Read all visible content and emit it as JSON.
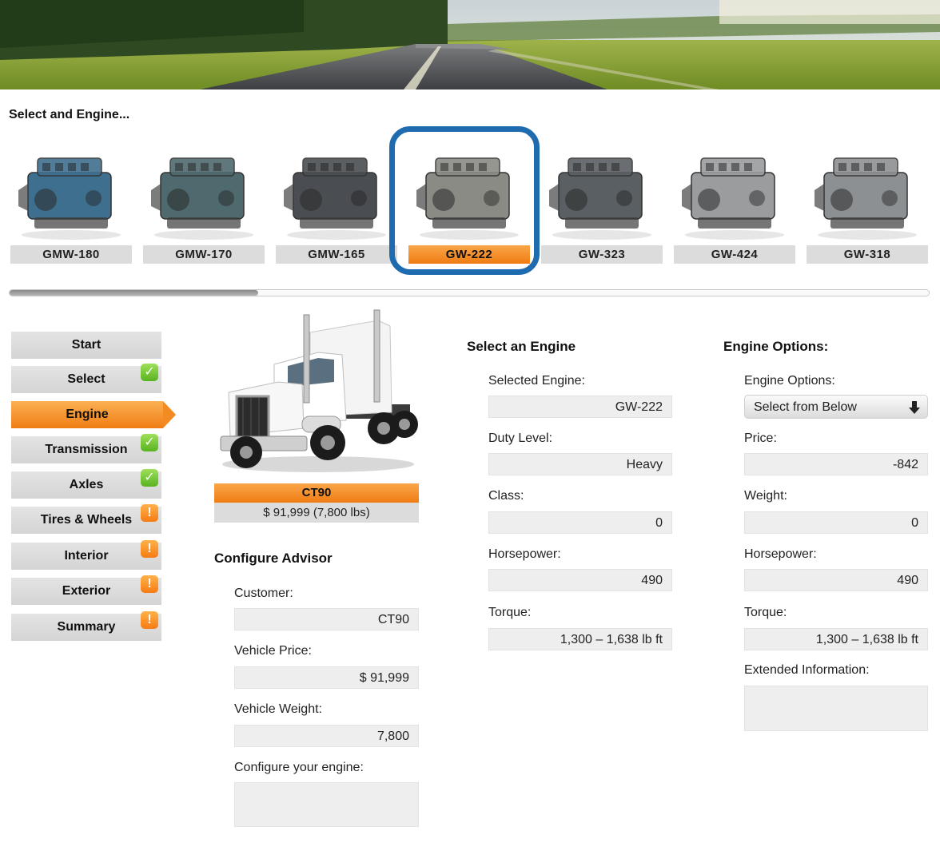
{
  "engine_selector": {
    "title": "Select and Engine...",
    "engines": [
      {
        "label": "GMW-180",
        "selected": false,
        "color": "#3f6f8e"
      },
      {
        "label": "GMW-170",
        "selected": false,
        "color": "#4f6a6e"
      },
      {
        "label": "GMW-165",
        "selected": false,
        "color": "#4a4e52"
      },
      {
        "label": "GW-222",
        "selected": true,
        "color": "#8b8b85"
      },
      {
        "label": "GW-323",
        "selected": false,
        "color": "#5a5f63"
      },
      {
        "label": "GW-424",
        "selected": false,
        "color": "#9a9c9e"
      },
      {
        "label": "GW-318",
        "selected": false,
        "color": "#8d9092"
      }
    ],
    "scroll_fraction": 0.27
  },
  "nav": {
    "items": [
      {
        "label": "Start",
        "status": "none"
      },
      {
        "label": "Select",
        "status": "complete"
      },
      {
        "label": "Engine",
        "status": "active"
      },
      {
        "label": "Transmission",
        "status": "complete"
      },
      {
        "label": "Axles",
        "status": "complete"
      },
      {
        "label": "Tires & Wheels",
        "status": "warning"
      },
      {
        "label": "Interior",
        "status": "warning"
      },
      {
        "label": "Exterior",
        "status": "warning"
      },
      {
        "label": "Summary",
        "status": "warning"
      }
    ]
  },
  "truck": {
    "name": "CT90",
    "price_weight": "$ 91,999 (7,800 lbs)"
  },
  "configure_advisor": {
    "title": "Configure Advisor",
    "customer_label": "Customer:",
    "customer_value": "CT90",
    "vehicle_price_label": "Vehicle Price:",
    "vehicle_price_value": "$ 91,999",
    "vehicle_weight_label": "Vehicle Weight:",
    "vehicle_weight_value": "7,800",
    "configure_label": "Configure your engine:",
    "configure_value": ""
  },
  "select_engine": {
    "title": "Select an Engine",
    "selected_engine_label": "Selected Engine:",
    "selected_engine_value": "GW-222",
    "duty_level_label": "Duty Level:",
    "duty_level_value": "Heavy",
    "class_label": "Class:",
    "class_value": "0",
    "horsepower_label": "Horsepower:",
    "horsepower_value": "490",
    "torque_label": "Torque:",
    "torque_value": "1,300 – 1,638 lb ft"
  },
  "engine_options": {
    "title": "Engine Options:",
    "options_label": "Engine Options:",
    "options_value": "Select from Below",
    "price_label": "Price:",
    "price_value": "-842",
    "weight_label": "Weight:",
    "weight_value": "0",
    "horsepower_label": "Horsepower:",
    "horsepower_value": "490",
    "torque_label": "Torque:",
    "torque_value": "1,300 – 1,638 lb ft",
    "extended_label": "Extended Information:",
    "extended_value": ""
  },
  "colors": {
    "accent_orange": "#f07c12",
    "selection_blue": "#1f6bb0",
    "ok_green": "#58b320"
  }
}
